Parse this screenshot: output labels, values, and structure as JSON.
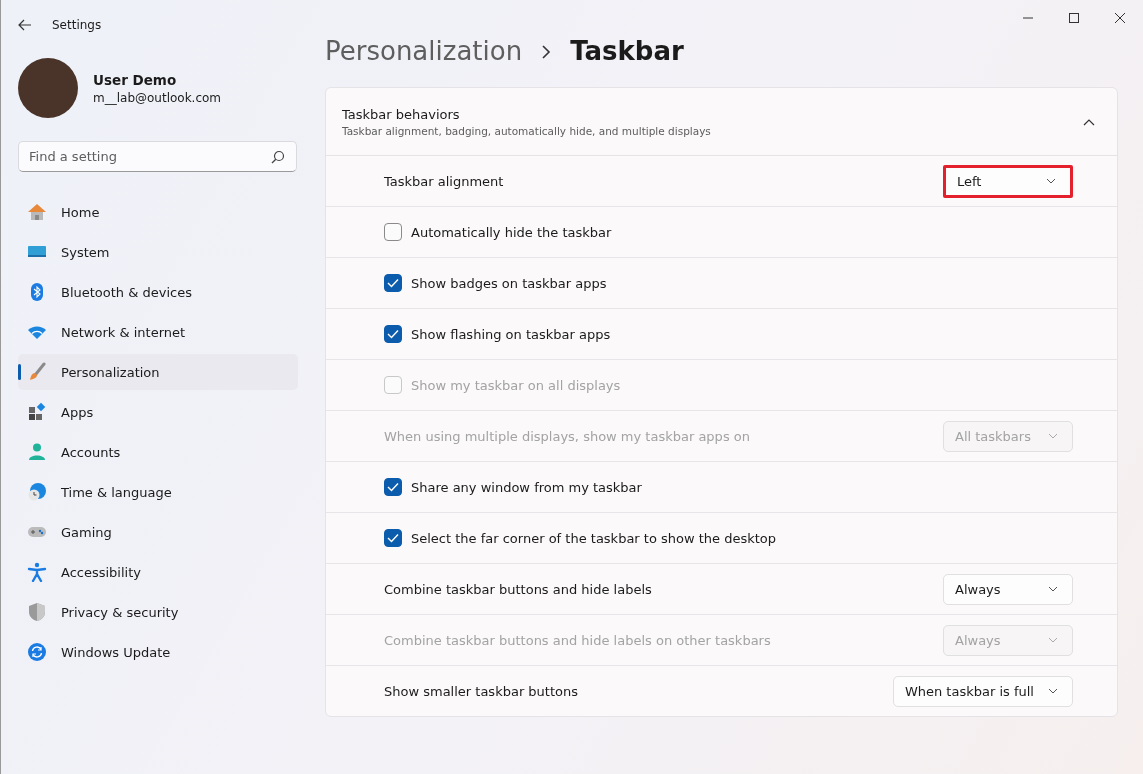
{
  "window": {
    "title": "Settings"
  },
  "account": {
    "name": "User Demo",
    "email": "m__lab@outlook.com"
  },
  "search": {
    "placeholder": "Find a setting"
  },
  "sidebar": {
    "items": [
      {
        "label": "Home",
        "selected": false
      },
      {
        "label": "System",
        "selected": false
      },
      {
        "label": "Bluetooth & devices",
        "selected": false
      },
      {
        "label": "Network & internet",
        "selected": false
      },
      {
        "label": "Personalization",
        "selected": true
      },
      {
        "label": "Apps",
        "selected": false
      },
      {
        "label": "Accounts",
        "selected": false
      },
      {
        "label": "Time & language",
        "selected": false
      },
      {
        "label": "Gaming",
        "selected": false
      },
      {
        "label": "Accessibility",
        "selected": false
      },
      {
        "label": "Privacy & security",
        "selected": false
      },
      {
        "label": "Windows Update",
        "selected": false
      }
    ]
  },
  "breadcrumb": [
    "Personalization",
    "Taskbar"
  ],
  "section": {
    "title": "Taskbar behaviors",
    "subtitle": "Taskbar alignment, badging, automatically hide, and multiple displays",
    "expanded": true,
    "rows": [
      {
        "kind": "dropdown",
        "label": "Taskbar alignment",
        "value": "Left",
        "disabled": false,
        "highlighted": true
      },
      {
        "kind": "checkbox",
        "label": "Automatically hide the taskbar",
        "checked": false,
        "disabled": false
      },
      {
        "kind": "checkbox",
        "label": "Show badges on taskbar apps",
        "checked": true,
        "disabled": false
      },
      {
        "kind": "checkbox",
        "label": "Show flashing on taskbar apps",
        "checked": true,
        "disabled": false
      },
      {
        "kind": "checkbox",
        "label": "Show my taskbar on all displays",
        "checked": false,
        "disabled": true
      },
      {
        "kind": "dropdown",
        "label": "When using multiple displays, show my taskbar apps on",
        "value": "All taskbars",
        "disabled": true,
        "highlighted": false
      },
      {
        "kind": "checkbox",
        "label": "Share any window from my taskbar",
        "checked": true,
        "disabled": false
      },
      {
        "kind": "checkbox",
        "label": "Select the far corner of the taskbar to show the desktop",
        "checked": true,
        "disabled": false
      },
      {
        "kind": "dropdown",
        "label": "Combine taskbar buttons and hide labels",
        "value": "Always",
        "disabled": false,
        "highlighted": false
      },
      {
        "kind": "dropdown",
        "label": "Combine taskbar buttons and hide labels on other taskbars",
        "value": "Always",
        "disabled": true,
        "highlighted": false
      },
      {
        "kind": "dropdown",
        "label": "Show smaller taskbar buttons",
        "value": "When taskbar is full",
        "disabled": false,
        "highlighted": false
      }
    ]
  }
}
